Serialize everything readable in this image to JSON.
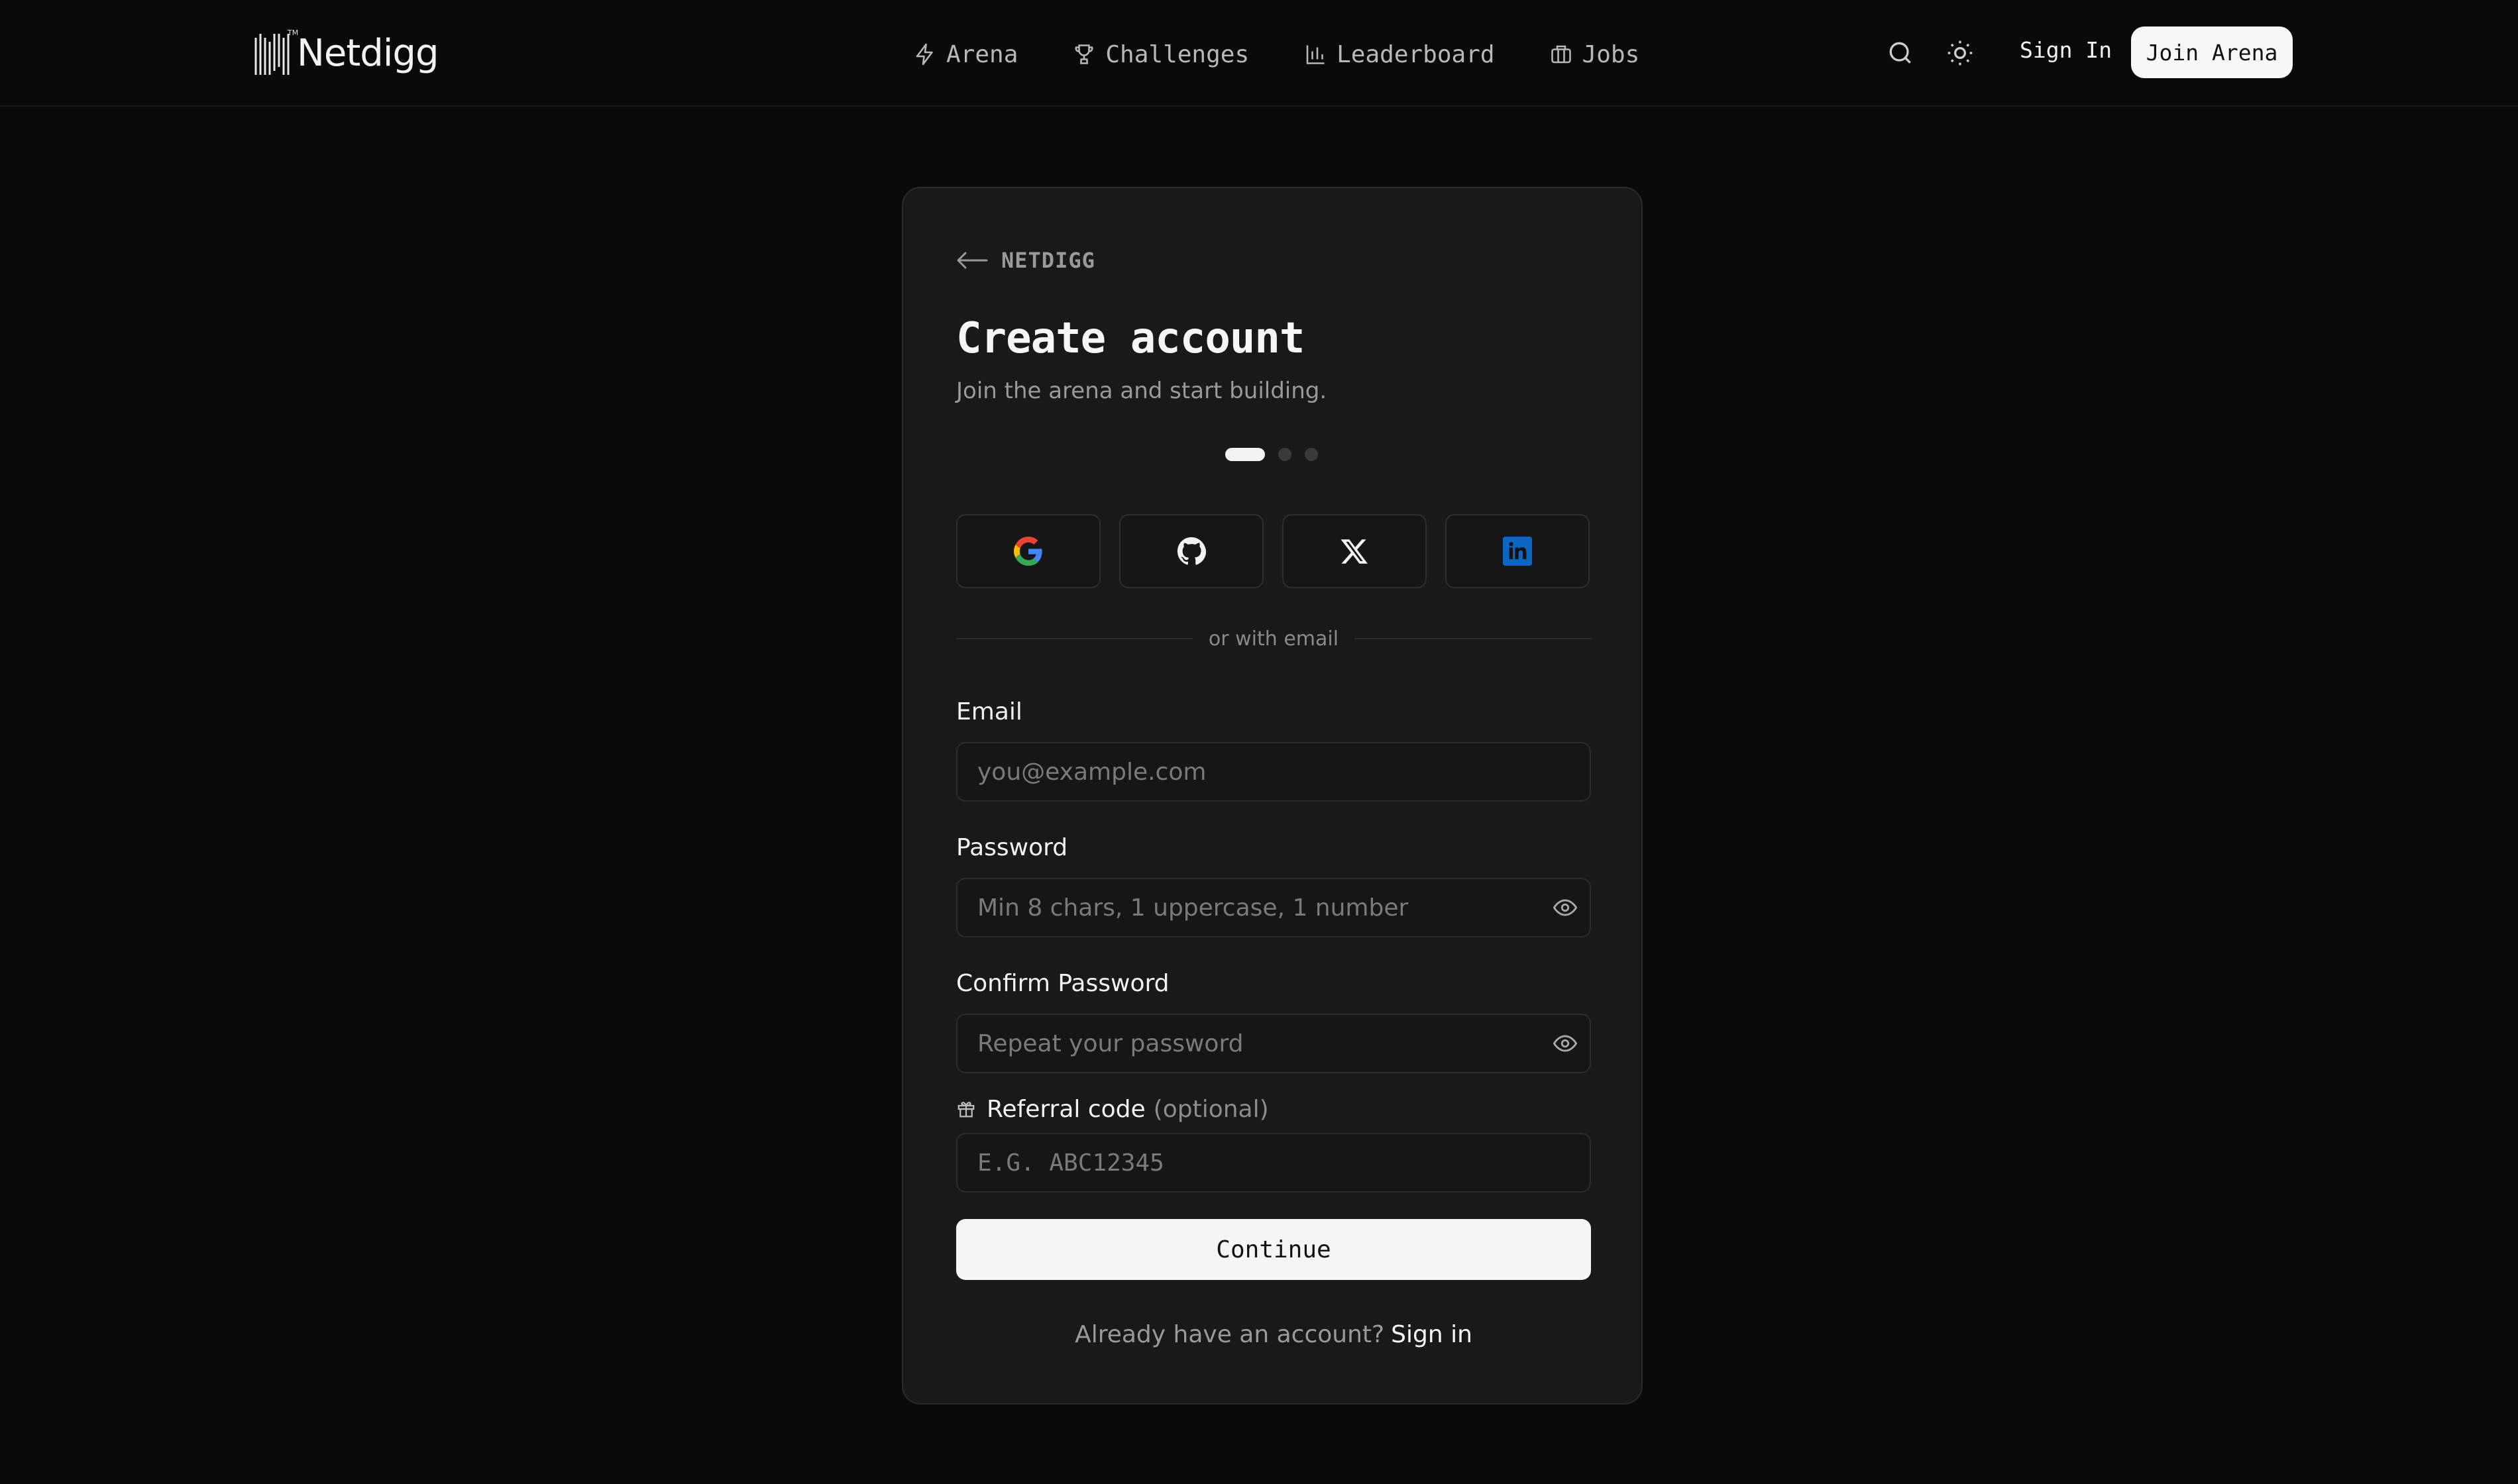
{
  "header": {
    "brand": "Netdigg",
    "trademark": "TM",
    "nav": [
      {
        "label": "Arena",
        "icon": "bolt-icon"
      },
      {
        "label": "Challenges",
        "icon": "trophy-icon"
      },
      {
        "label": "Leaderboard",
        "icon": "bar-chart-icon"
      },
      {
        "label": "Jobs",
        "icon": "briefcase-icon"
      }
    ],
    "sign_in": "Sign In",
    "join": "Join Arena"
  },
  "card": {
    "back_label": "NETDIGG",
    "title": "Create account",
    "subtitle": "Join the arena and start building.",
    "steps": {
      "total": 3,
      "current": 1
    },
    "socials": [
      "google-icon",
      "github-icon",
      "x-icon",
      "linkedin-icon"
    ],
    "divider": "or with email",
    "email": {
      "label": "Email",
      "placeholder": "you@example.com"
    },
    "password": {
      "label": "Password",
      "placeholder": "Min 8 chars, 1 uppercase, 1 number"
    },
    "confirm": {
      "label": "Confirm Password",
      "placeholder": "Repeat your password"
    },
    "referral": {
      "label": "Referral code",
      "optional": "(optional)",
      "placeholder": "E.G. ABC12345"
    },
    "continue": "Continue",
    "already": "Already have an account?",
    "sign_in_link": "Sign in"
  },
  "colors": {
    "background": "#0a0a0a",
    "card": "#191919",
    "accent": "#f5f5f5",
    "linkedin": "#0a66c2"
  }
}
